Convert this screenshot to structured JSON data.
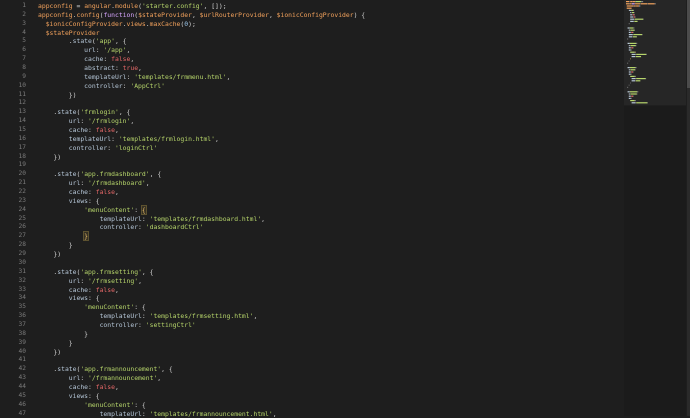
{
  "colors": {
    "background": "#1e1e1e",
    "line_number": "#7c7c7c",
    "variable": "#f3a25c",
    "property": "#b6c7d8",
    "string": "#b7d66b",
    "keyword": "#e46767",
    "number": "#9ecbf0",
    "function_keyword": "#d7a6ff"
  },
  "editor": {
    "lines": [
      {
        "n": "1",
        "tokens": [
          {
            "t": "appconfig",
            "c": "var"
          },
          {
            "t": " = ",
            "c": "pun"
          },
          {
            "t": "angular",
            "c": "var"
          },
          {
            "t": ".",
            "c": "pun"
          },
          {
            "t": "module",
            "c": "var"
          },
          {
            "t": "(",
            "c": "pun"
          },
          {
            "t": "'starter.config'",
            "c": "str"
          },
          {
            "t": ", []);",
            "c": "pun"
          }
        ]
      },
      {
        "n": "2",
        "tokens": [
          {
            "t": "appconfig",
            "c": "var"
          },
          {
            "t": ".",
            "c": "pun"
          },
          {
            "t": "config",
            "c": "var"
          },
          {
            "t": "(",
            "c": "pun"
          },
          {
            "t": "function",
            "c": "fn"
          },
          {
            "t": "(",
            "c": "pun"
          },
          {
            "t": "$stateProvider",
            "c": "var"
          },
          {
            "t": ", ",
            "c": "pun"
          },
          {
            "t": "$urlRouterProvider",
            "c": "var"
          },
          {
            "t": ", ",
            "c": "pun"
          },
          {
            "t": "$ionicConfigProvider",
            "c": "var"
          },
          {
            "t": ") {",
            "c": "pun"
          }
        ]
      },
      {
        "n": "3",
        "tokens": [
          {
            "t": "  ",
            "c": "pun"
          },
          {
            "t": "$ionicConfigProvider",
            "c": "var"
          },
          {
            "t": ".",
            "c": "pun"
          },
          {
            "t": "views",
            "c": "var"
          },
          {
            "t": ".",
            "c": "pun"
          },
          {
            "t": "maxCache",
            "c": "var"
          },
          {
            "t": "(",
            "c": "pun"
          },
          {
            "t": "0",
            "c": "num"
          },
          {
            "t": ");",
            "c": "pun"
          }
        ]
      },
      {
        "n": "4",
        "tokens": [
          {
            "t": "  ",
            "c": "pun"
          },
          {
            "t": "$stateProvider",
            "c": "var"
          }
        ]
      },
      {
        "n": "5",
        "tokens": [
          {
            "t": "        .",
            "c": "pun"
          },
          {
            "t": "state",
            "c": "key"
          },
          {
            "t": "(",
            "c": "pun"
          },
          {
            "t": "'app'",
            "c": "str"
          },
          {
            "t": ", {",
            "c": "pun"
          }
        ]
      },
      {
        "n": "6",
        "tokens": [
          {
            "t": "            ",
            "c": "pun"
          },
          {
            "t": "url",
            "c": "key"
          },
          {
            "t": ": ",
            "c": "pun"
          },
          {
            "t": "'/app'",
            "c": "str"
          },
          {
            "t": ",",
            "c": "pun"
          }
        ]
      },
      {
        "n": "7",
        "tokens": [
          {
            "t": "            ",
            "c": "pun"
          },
          {
            "t": "cache",
            "c": "key"
          },
          {
            "t": ": ",
            "c": "pun"
          },
          {
            "t": "false",
            "c": "kw"
          },
          {
            "t": ",",
            "c": "pun"
          }
        ]
      },
      {
        "n": "8",
        "tokens": [
          {
            "t": "            ",
            "c": "pun"
          },
          {
            "t": "abstract",
            "c": "key"
          },
          {
            "t": ": ",
            "c": "pun"
          },
          {
            "t": "true",
            "c": "kw"
          },
          {
            "t": ",",
            "c": "pun"
          }
        ]
      },
      {
        "n": "9",
        "tokens": [
          {
            "t": "            ",
            "c": "pun"
          },
          {
            "t": "templateUrl",
            "c": "key"
          },
          {
            "t": ": ",
            "c": "pun"
          },
          {
            "t": "'templates/frmmenu.html'",
            "c": "str"
          },
          {
            "t": ",",
            "c": "pun"
          }
        ]
      },
      {
        "n": "10",
        "tokens": [
          {
            "t": "            ",
            "c": "pun"
          },
          {
            "t": "controller",
            "c": "key"
          },
          {
            "t": ": ",
            "c": "pun"
          },
          {
            "t": "'AppCtrl'",
            "c": "str"
          }
        ]
      },
      {
        "n": "11",
        "tokens": [
          {
            "t": "        })",
            "c": "pun"
          }
        ]
      },
      {
        "n": "12",
        "tokens": []
      },
      {
        "n": "13",
        "tokens": [
          {
            "t": "    .",
            "c": "pun"
          },
          {
            "t": "state",
            "c": "key"
          },
          {
            "t": "(",
            "c": "pun"
          },
          {
            "t": "'frmlogin'",
            "c": "str"
          },
          {
            "t": ", {",
            "c": "pun"
          }
        ]
      },
      {
        "n": "14",
        "tokens": [
          {
            "t": "        ",
            "c": "pun"
          },
          {
            "t": "url",
            "c": "key"
          },
          {
            "t": ": ",
            "c": "pun"
          },
          {
            "t": "'/frmlogin'",
            "c": "str"
          },
          {
            "t": ",",
            "c": "pun"
          }
        ]
      },
      {
        "n": "15",
        "tokens": [
          {
            "t": "        ",
            "c": "pun"
          },
          {
            "t": "cache",
            "c": "key"
          },
          {
            "t": ": ",
            "c": "pun"
          },
          {
            "t": "false",
            "c": "kw"
          },
          {
            "t": ",",
            "c": "pun"
          }
        ]
      },
      {
        "n": "16",
        "tokens": [
          {
            "t": "        ",
            "c": "pun"
          },
          {
            "t": "templateUrl",
            "c": "key"
          },
          {
            "t": ": ",
            "c": "pun"
          },
          {
            "t": "'templates/frmlogin.html'",
            "c": "str"
          },
          {
            "t": ",",
            "c": "pun"
          }
        ]
      },
      {
        "n": "17",
        "tokens": [
          {
            "t": "        ",
            "c": "pun"
          },
          {
            "t": "controller",
            "c": "key"
          },
          {
            "t": ": ",
            "c": "pun"
          },
          {
            "t": "'loginCtrl'",
            "c": "str"
          }
        ]
      },
      {
        "n": "18",
        "tokens": [
          {
            "t": "    })",
            "c": "pun"
          }
        ]
      },
      {
        "n": "19",
        "tokens": []
      },
      {
        "n": "20",
        "tokens": [
          {
            "t": "    .",
            "c": "pun"
          },
          {
            "t": "state",
            "c": "key"
          },
          {
            "t": "(",
            "c": "pun"
          },
          {
            "t": "'app.frmdashboard'",
            "c": "str"
          },
          {
            "t": ", {",
            "c": "pun"
          }
        ]
      },
      {
        "n": "21",
        "tokens": [
          {
            "t": "        ",
            "c": "pun"
          },
          {
            "t": "url",
            "c": "key"
          },
          {
            "t": ": ",
            "c": "pun"
          },
          {
            "t": "'/frmdashboard'",
            "c": "str"
          },
          {
            "t": ",",
            "c": "pun"
          }
        ]
      },
      {
        "n": "22",
        "tokens": [
          {
            "t": "        ",
            "c": "pun"
          },
          {
            "t": "cache",
            "c": "key"
          },
          {
            "t": ": ",
            "c": "pun"
          },
          {
            "t": "false",
            "c": "kw"
          },
          {
            "t": ",",
            "c": "pun"
          }
        ]
      },
      {
        "n": "23",
        "tokens": [
          {
            "t": "        ",
            "c": "pun"
          },
          {
            "t": "views",
            "c": "key"
          },
          {
            "t": ": {",
            "c": "pun"
          }
        ]
      },
      {
        "n": "24",
        "tokens": [
          {
            "t": "            ",
            "c": "pun"
          },
          {
            "t": "'menuContent'",
            "c": "str"
          },
          {
            "t": ": ",
            "c": "pun"
          },
          {
            "t": "{",
            "c": "brk"
          }
        ]
      },
      {
        "n": "25",
        "tokens": [
          {
            "t": "                ",
            "c": "pun"
          },
          {
            "t": "templateUrl",
            "c": "key"
          },
          {
            "t": ": ",
            "c": "pun"
          },
          {
            "t": "'templates/frmdashboard.html'",
            "c": "str"
          },
          {
            "t": ",",
            "c": "pun"
          }
        ]
      },
      {
        "n": "26",
        "tokens": [
          {
            "t": "                ",
            "c": "pun"
          },
          {
            "t": "controller",
            "c": "key"
          },
          {
            "t": ": ",
            "c": "pun"
          },
          {
            "t": "'dashboardCtrl'",
            "c": "str"
          }
        ]
      },
      {
        "n": "27",
        "tokens": [
          {
            "t": "            ",
            "c": "pun"
          },
          {
            "t": "}",
            "c": "brk"
          }
        ]
      },
      {
        "n": "28",
        "tokens": [
          {
            "t": "        }",
            "c": "pun"
          }
        ]
      },
      {
        "n": "29",
        "tokens": [
          {
            "t": "    })",
            "c": "pun"
          }
        ]
      },
      {
        "n": "30",
        "tokens": []
      },
      {
        "n": "31",
        "tokens": [
          {
            "t": "    .",
            "c": "pun"
          },
          {
            "t": "state",
            "c": "key"
          },
          {
            "t": "(",
            "c": "pun"
          },
          {
            "t": "'app.frmsetting'",
            "c": "str"
          },
          {
            "t": ", {",
            "c": "pun"
          }
        ]
      },
      {
        "n": "32",
        "tokens": [
          {
            "t": "        ",
            "c": "pun"
          },
          {
            "t": "url",
            "c": "key"
          },
          {
            "t": ": ",
            "c": "pun"
          },
          {
            "t": "'/frmsetting'",
            "c": "str"
          },
          {
            "t": ",",
            "c": "pun"
          }
        ]
      },
      {
        "n": "33",
        "tokens": [
          {
            "t": "        ",
            "c": "pun"
          },
          {
            "t": "cache",
            "c": "key"
          },
          {
            "t": ": ",
            "c": "pun"
          },
          {
            "t": "false",
            "c": "kw"
          },
          {
            "t": ",",
            "c": "pun"
          }
        ]
      },
      {
        "n": "34",
        "tokens": [
          {
            "t": "        ",
            "c": "pun"
          },
          {
            "t": "views",
            "c": "key"
          },
          {
            "t": ": {",
            "c": "pun"
          }
        ]
      },
      {
        "n": "35",
        "tokens": [
          {
            "t": "            ",
            "c": "pun"
          },
          {
            "t": "'menuContent'",
            "c": "str"
          },
          {
            "t": ": {",
            "c": "pun"
          }
        ]
      },
      {
        "n": "36",
        "tokens": [
          {
            "t": "                ",
            "c": "pun"
          },
          {
            "t": "templateUrl",
            "c": "key"
          },
          {
            "t": ": ",
            "c": "pun"
          },
          {
            "t": "'templates/frmsetting.html'",
            "c": "str"
          },
          {
            "t": ",",
            "c": "pun"
          }
        ]
      },
      {
        "n": "37",
        "tokens": [
          {
            "t": "                ",
            "c": "pun"
          },
          {
            "t": "controller",
            "c": "key"
          },
          {
            "t": ": ",
            "c": "pun"
          },
          {
            "t": "'settingCtrl'",
            "c": "str"
          }
        ]
      },
      {
        "n": "38",
        "tokens": [
          {
            "t": "            }",
            "c": "pun"
          }
        ]
      },
      {
        "n": "39",
        "tokens": [
          {
            "t": "        }",
            "c": "pun"
          }
        ]
      },
      {
        "n": "40",
        "tokens": [
          {
            "t": "    })",
            "c": "pun"
          }
        ]
      },
      {
        "n": "41",
        "tokens": []
      },
      {
        "n": "42",
        "tokens": [
          {
            "t": "    .",
            "c": "pun"
          },
          {
            "t": "state",
            "c": "key"
          },
          {
            "t": "(",
            "c": "pun"
          },
          {
            "t": "'app.frmannouncement'",
            "c": "str"
          },
          {
            "t": ", {",
            "c": "pun"
          }
        ]
      },
      {
        "n": "43",
        "tokens": [
          {
            "t": "        ",
            "c": "pun"
          },
          {
            "t": "url",
            "c": "key"
          },
          {
            "t": ": ",
            "c": "pun"
          },
          {
            "t": "'/frmannouncement'",
            "c": "str"
          },
          {
            "t": ",",
            "c": "pun"
          }
        ]
      },
      {
        "n": "44",
        "tokens": [
          {
            "t": "        ",
            "c": "pun"
          },
          {
            "t": "cache",
            "c": "key"
          },
          {
            "t": ": ",
            "c": "pun"
          },
          {
            "t": "false",
            "c": "kw"
          },
          {
            "t": ",",
            "c": "pun"
          }
        ]
      },
      {
        "n": "45",
        "tokens": [
          {
            "t": "        ",
            "c": "pun"
          },
          {
            "t": "views",
            "c": "key"
          },
          {
            "t": ": {",
            "c": "pun"
          }
        ]
      },
      {
        "n": "46",
        "tokens": [
          {
            "t": "            ",
            "c": "pun"
          },
          {
            "t": "'menuContent'",
            "c": "str"
          },
          {
            "t": ": {",
            "c": "pun"
          }
        ]
      },
      {
        "n": "47",
        "tokens": [
          {
            "t": "                ",
            "c": "pun"
          },
          {
            "t": "templateUrl",
            "c": "key"
          },
          {
            "t": ": ",
            "c": "pun"
          },
          {
            "t": "'templates/frmannouncement.html'",
            "c": "str"
          },
          {
            "t": ",",
            "c": "pun"
          }
        ]
      }
    ]
  }
}
